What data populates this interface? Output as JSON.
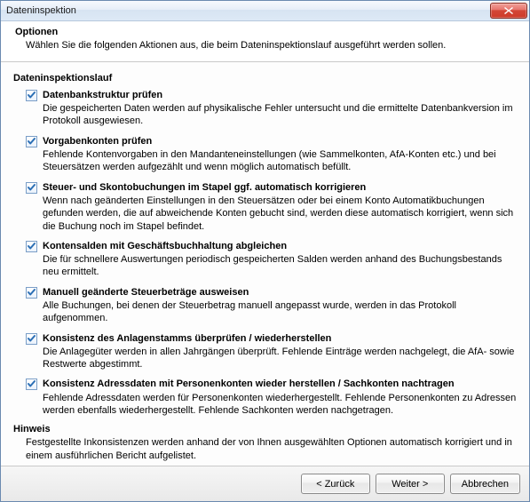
{
  "window": {
    "title": "Dateninspektion"
  },
  "header": {
    "title": "Optionen",
    "description": "Wählen Sie die folgenden Aktionen aus, die beim Dateninspektionslauf ausgeführt werden sollen."
  },
  "section_title": "Dateninspektionslauf",
  "items": [
    {
      "label": "Datenbankstruktur prüfen",
      "desc": "Die gespeicherten Daten werden auf physikalische Fehler untersucht und die ermittelte Datenbankversion im Protokoll ausgewiesen.",
      "checked": true
    },
    {
      "label": "Vorgabenkonten prüfen",
      "desc": "Fehlende Kontenvorgaben in den Mandanteneinstellungen (wie Sammelkonten, AfA-Konten etc.) und bei Steuersätzen werden aufgezählt und wenn möglich automatisch befüllt.",
      "checked": true
    },
    {
      "label": "Steuer- und Skontobuchungen im Stapel ggf. automatisch korrigieren",
      "desc": "Wenn nach geänderten Einstellungen in den Steuersätzen oder bei einem Konto Automatikbuchungen gefunden werden, die auf abweichende Konten gebucht sind, werden diese automatisch korrigiert, wenn sich die Buchung noch im Stapel befindet.",
      "checked": true
    },
    {
      "label": "Kontensalden mit Geschäftsbuchhaltung abgleichen",
      "desc": "Die für schnellere Auswertungen periodisch gespeicherten Salden werden anhand des Buchungsbestands neu ermittelt.",
      "checked": true
    },
    {
      "label": "Manuell geänderte Steuerbeträge ausweisen",
      "desc": "Alle Buchungen, bei denen der Steuerbetrag manuell angepasst wurde, werden in das Protokoll aufgenommen.",
      "checked": true
    },
    {
      "label": "Konsistenz des Anlagenstamms überprüfen / wiederherstellen",
      "desc": "Die Anlagegüter werden in allen Jahrgängen überprüft. Fehlende Einträge werden nachgelegt, die AfA- sowie Restwerte abgestimmt.",
      "checked": true
    },
    {
      "label": "Konsistenz Adressdaten mit Personenkonten wieder herstellen / Sachkonten nachtragen",
      "desc": "Fehlende Adressdaten werden für Personenkonten wiederhergestellt. Fehlende Personenkonten zu Adressen werden ebenfalls wiederhergestellt. Fehlende Sachkonten werden nachgetragen.",
      "checked": true
    }
  ],
  "hint": {
    "label": "Hinweis",
    "desc": "Festgestellte Inkonsistenzen werden anhand der von Ihnen ausgewählten Optionen automatisch korrigiert und in einem ausführlichen Bericht aufgelistet."
  },
  "buttons": {
    "back": "< Zurück",
    "next": "Weiter >",
    "cancel": "Abbrechen"
  }
}
